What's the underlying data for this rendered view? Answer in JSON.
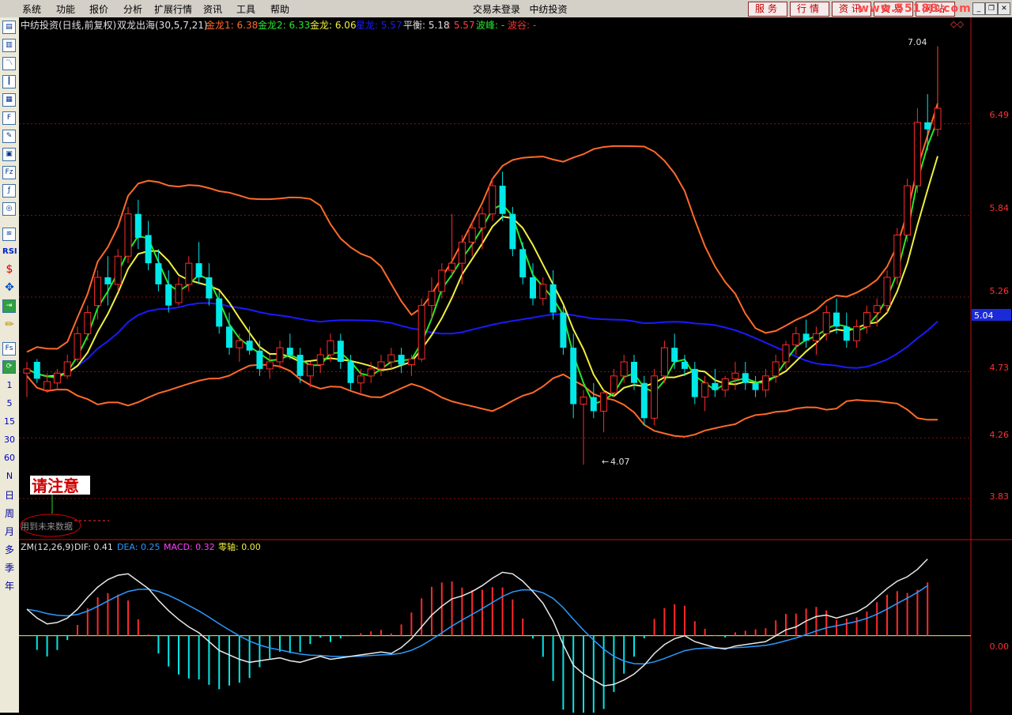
{
  "menu": [
    "系统",
    "功能",
    "报价",
    "分析",
    "扩展行情",
    "资讯",
    "工具",
    "帮助"
  ],
  "status": {
    "login": "交易未登录",
    "stock": "中纺投资"
  },
  "right_buttons": [
    "服务",
    "行情",
    "资讯",
    "交易",
    "网站"
  ],
  "site_logo": "www.55188.com",
  "toolbar": {
    "icons": [
      "chart-icon",
      "kline-icon",
      "trend-icon",
      "candle-icon",
      "book-icon",
      "table-icon",
      "f10-icon",
      "note-icon",
      "calendar-icon",
      "fz-icon",
      "formula-icon",
      "magnifier-icon",
      "stats-icon",
      "rsi-icon",
      "dollar-icon",
      "arrows-icon",
      "export-icon",
      "pencil-icon",
      "fs-icon",
      "refresh-icon"
    ],
    "fs_label": "Fs",
    "rsi_label": "RSI",
    "periods": [
      "1",
      "5",
      "15",
      "30",
      "60",
      "N"
    ],
    "cn_periods": [
      "日",
      "周",
      "月",
      "多",
      "季",
      "年"
    ]
  },
  "main_header": {
    "title": "中纺投资(日线,前复权)",
    "indicator": "双龙出海(30,5,7,21)",
    "items": [
      {
        "label": "金龙1: 6.38",
        "color": "#ff6a2a"
      },
      {
        "label": "金龙2: 6.33",
        "color": "#28e828"
      },
      {
        "label": "金龙: 6.06",
        "color": "#f0f040"
      },
      {
        "label": "星龙: 5.57",
        "color": "#1a1aff"
      },
      {
        "label": "平衡: 5.18",
        "color": "#e0e0e0"
      },
      {
        "label": ": 5.57",
        "color": "#ff4040"
      },
      {
        "label": "波峰: -",
        "color": "#28e828"
      },
      {
        "label": "波谷: -",
        "color": "#ff3030"
      }
    ]
  },
  "price_axis": [
    "6.49",
    "5.84",
    "5.26",
    "4.73",
    "4.26",
    "3.83"
  ],
  "current_price": "5.04",
  "annotations": {
    "high": "7.04",
    "low": "4.07",
    "notice": "请注意",
    "future_data": "用到未来数据"
  },
  "macd_header": {
    "name": "ZM(12,26,9)",
    "items": [
      {
        "label": "DIF: 0.41",
        "color": "#e0e0e0"
      },
      {
        "label": "DEA: 0.25",
        "color": "#2a9aff"
      },
      {
        "label": "MACD: 0.32",
        "color": "#ff40ff"
      },
      {
        "label": "零轴: 0.00",
        "color": "#f0f040"
      }
    ]
  },
  "macd_axis": [
    "0.00"
  ],
  "colors": {
    "up": "#ff2a2a",
    "down": "#00e8e8",
    "bg": "#000000",
    "grid": "#8a1010"
  },
  "chart_data": {
    "type": "candlestick",
    "price_ylim": [
      3.6,
      7.2
    ],
    "candles": [
      [
        4.72,
        4.8,
        4.55,
        4.75
      ],
      [
        4.8,
        4.82,
        4.65,
        4.68
      ],
      [
        4.6,
        4.72,
        4.58,
        4.66
      ],
      [
        4.65,
        4.75,
        4.6,
        4.72
      ],
      [
        4.7,
        4.85,
        4.68,
        4.8
      ],
      [
        4.82,
        5.05,
        4.8,
        5.0
      ],
      [
        5.0,
        5.2,
        4.95,
        5.15
      ],
      [
        5.2,
        5.45,
        5.1,
        5.4
      ],
      [
        5.4,
        5.55,
        5.2,
        5.35
      ],
      [
        5.35,
        5.6,
        5.3,
        5.55
      ],
      [
        5.55,
        5.9,
        5.5,
        5.85
      ],
      [
        5.85,
        5.95,
        5.6,
        5.68
      ],
      [
        5.7,
        5.8,
        5.45,
        5.5
      ],
      [
        5.5,
        5.6,
        5.3,
        5.35
      ],
      [
        5.35,
        5.45,
        5.15,
        5.2
      ],
      [
        5.22,
        5.4,
        5.2,
        5.35
      ],
      [
        5.35,
        5.55,
        5.3,
        5.5
      ],
      [
        5.5,
        5.65,
        5.35,
        5.4
      ],
      [
        5.4,
        5.5,
        5.2,
        5.25
      ],
      [
        5.25,
        5.3,
        5.0,
        5.05
      ],
      [
        5.05,
        5.15,
        4.85,
        4.9
      ],
      [
        4.9,
        5.0,
        4.8,
        4.95
      ],
      [
        4.95,
        5.05,
        4.85,
        4.88
      ],
      [
        4.88,
        4.95,
        4.7,
        4.75
      ],
      [
        4.75,
        4.85,
        4.68,
        4.8
      ],
      [
        4.8,
        4.95,
        4.75,
        4.9
      ],
      [
        4.9,
        5.0,
        4.82,
        4.85
      ],
      [
        4.85,
        4.9,
        4.65,
        4.7
      ],
      [
        4.7,
        4.8,
        4.62,
        4.78
      ],
      [
        4.78,
        4.9,
        4.72,
        4.85
      ],
      [
        4.85,
        5.0,
        4.8,
        4.95
      ],
      [
        4.95,
        5.0,
        4.75,
        4.8
      ],
      [
        4.8,
        4.85,
        4.6,
        4.65
      ],
      [
        4.65,
        4.75,
        4.58,
        4.7
      ],
      [
        4.7,
        4.8,
        4.65,
        4.75
      ],
      [
        4.75,
        4.85,
        4.7,
        4.8
      ],
      [
        4.8,
        4.9,
        4.75,
        4.85
      ],
      [
        4.85,
        4.9,
        4.72,
        4.78
      ],
      [
        4.78,
        4.85,
        4.7,
        4.82
      ],
      [
        4.82,
        5.25,
        4.8,
        5.2
      ],
      [
        5.2,
        5.4,
        5.1,
        5.3
      ],
      [
        5.3,
        5.5,
        5.25,
        5.45
      ],
      [
        5.45,
        5.85,
        5.4,
        5.5
      ],
      [
        5.5,
        5.7,
        5.35,
        5.65
      ],
      [
        5.65,
        5.8,
        5.55,
        5.75
      ],
      [
        5.75,
        5.9,
        5.6,
        5.85
      ],
      [
        5.85,
        6.1,
        5.8,
        6.05
      ],
      [
        6.05,
        6.15,
        5.8,
        5.85
      ],
      [
        5.85,
        5.9,
        5.55,
        5.6
      ],
      [
        5.6,
        5.65,
        5.35,
        5.4
      ],
      [
        5.4,
        5.5,
        5.2,
        5.25
      ],
      [
        5.25,
        5.4,
        5.2,
        5.35
      ],
      [
        5.35,
        5.45,
        5.1,
        5.15
      ],
      [
        5.15,
        5.2,
        4.85,
        4.9
      ],
      [
        4.9,
        5.0,
        4.4,
        4.5
      ],
      [
        4.5,
        4.6,
        4.07,
        4.55
      ],
      [
        4.55,
        4.65,
        4.4,
        4.45
      ],
      [
        4.45,
        4.6,
        4.3,
        4.58
      ],
      [
        4.58,
        4.75,
        4.55,
        4.7
      ],
      [
        4.7,
        4.85,
        4.65,
        4.8
      ],
      [
        4.8,
        4.85,
        4.6,
        4.65
      ],
      [
        4.65,
        4.7,
        4.35,
        4.4
      ],
      [
        4.4,
        4.75,
        4.35,
        4.7
      ],
      [
        4.7,
        4.95,
        4.65,
        4.9
      ],
      [
        4.9,
        5.0,
        4.75,
        4.8
      ],
      [
        4.8,
        4.85,
        4.7,
        4.75
      ],
      [
        4.75,
        4.8,
        4.5,
        4.55
      ],
      [
        4.55,
        4.7,
        4.45,
        4.65
      ],
      [
        4.65,
        4.75,
        4.55,
        4.6
      ],
      [
        4.6,
        4.7,
        4.55,
        4.68
      ],
      [
        4.68,
        4.8,
        4.6,
        4.72
      ],
      [
        4.72,
        4.8,
        4.6,
        4.65
      ],
      [
        4.65,
        4.7,
        4.55,
        4.6
      ],
      [
        4.6,
        4.75,
        4.55,
        4.7
      ],
      [
        4.7,
        4.85,
        4.65,
        4.8
      ],
      [
        4.8,
        4.95,
        4.75,
        4.92
      ],
      [
        4.92,
        5.05,
        4.85,
        5.0
      ],
      [
        5.0,
        5.1,
        4.9,
        4.95
      ],
      [
        4.95,
        5.05,
        4.85,
        5.0
      ],
      [
        5.0,
        5.2,
        4.95,
        5.15
      ],
      [
        5.15,
        5.25,
        5.0,
        5.05
      ],
      [
        5.05,
        5.15,
        4.9,
        4.95
      ],
      [
        4.95,
        5.1,
        4.9,
        5.05
      ],
      [
        5.05,
        5.2,
        5.0,
        5.15
      ],
      [
        5.15,
        5.25,
        5.05,
        5.2
      ],
      [
        5.2,
        5.45,
        5.15,
        5.4
      ],
      [
        5.4,
        5.75,
        5.35,
        5.7
      ],
      [
        5.7,
        6.1,
        5.65,
        6.05
      ],
      [
        6.05,
        6.6,
        6.0,
        6.5
      ],
      [
        6.5,
        6.7,
        6.3,
        6.45
      ],
      [
        6.45,
        7.04,
        6.4,
        6.6
      ]
    ],
    "macd_ylim": [
      -0.5,
      0.55
    ],
    "dif": [
      0.18,
      0.12,
      0.08,
      0.09,
      0.12,
      0.18,
      0.26,
      0.33,
      0.38,
      0.41,
      0.42,
      0.37,
      0.32,
      0.24,
      0.17,
      0.11,
      0.06,
      0.02,
      -0.04,
      -0.1,
      -0.13,
      -0.16,
      -0.18,
      -0.17,
      -0.16,
      -0.15,
      -0.17,
      -0.18,
      -0.16,
      -0.14,
      -0.16,
      -0.15,
      -0.14,
      -0.13,
      -0.12,
      -0.11,
      -0.12,
      -0.08,
      -0.02,
      0.06,
      0.14,
      0.2,
      0.25,
      0.27,
      0.3,
      0.34,
      0.39,
      0.43,
      0.42,
      0.37,
      0.3,
      0.22,
      0.1,
      -0.06,
      -0.2,
      -0.26,
      -0.3,
      -0.34,
      -0.33,
      -0.3,
      -0.26,
      -0.2,
      -0.12,
      -0.06,
      -0.02,
      0.0,
      -0.04,
      -0.06,
      -0.08,
      -0.09,
      -0.07,
      -0.06,
      -0.05,
      -0.04,
      0.0,
      0.04,
      0.06,
      0.1,
      0.13,
      0.14,
      0.12,
      0.14,
      0.16,
      0.2,
      0.26,
      0.32,
      0.37,
      0.4,
      0.45,
      0.52
    ]
  }
}
